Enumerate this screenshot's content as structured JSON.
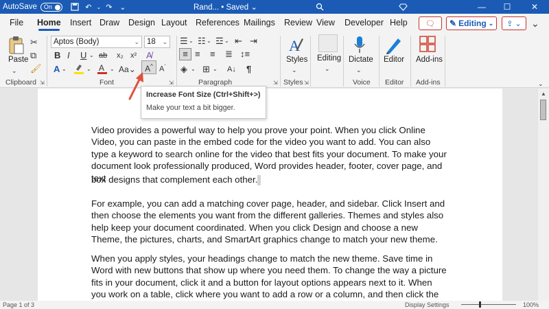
{
  "titlebar": {
    "autosave_label": "AutoSave",
    "autosave_state": "On",
    "doc_title": "Rand... • Saved",
    "doc_title_chevron": "⌄"
  },
  "tabs": [
    "File",
    "Home",
    "Insert",
    "Draw",
    "Design",
    "Layout",
    "References",
    "Mailings",
    "Review",
    "View",
    "Developer",
    "Help"
  ],
  "active_tab": "Home",
  "header_buttons": {
    "editing_label": "Editing"
  },
  "ribbon": {
    "clipboard": {
      "paste_label": "Paste",
      "group_label": "Clipboard"
    },
    "font": {
      "font_name": "Aptos (Body)",
      "font_size": "18",
      "group_label": "Font",
      "increase_font_label": "A^",
      "case_label": "Aa"
    },
    "paragraph": {
      "group_label": "Paragraph"
    },
    "styles": {
      "label": "Styles",
      "group_label": "Styles"
    },
    "editing": {
      "label": "Editing"
    },
    "voice": {
      "dictate_label": "Dictate",
      "group_label": "Voice"
    },
    "editor": {
      "label": "Editor",
      "group_label": "Editor"
    },
    "addins": {
      "label": "Add-ins",
      "group_label": "Add-ins"
    }
  },
  "tooltip": {
    "title": "Increase Font Size (Ctrl+Shift+>)",
    "description": "Make your text a bit bigger."
  },
  "document": {
    "paragraphs": [
      "Video provides a powerful way to help you prove your point. When you click Online Video, you can paste in the embed code for the video you want to add. You can also type a keyword to search online for the video that best fits your document. To make your document look professionally produced, Word provides header, footer, cover page, and text",
      "box designs that complement each other.",
      "For example, you can add a matching cover page, header, and sidebar. Click Insert and then choose the elements you want from the different galleries. Themes and styles also help keep your document coordinated. When you click Design and choose a new Theme, the pictures, charts, and SmartArt graphics change to match your new theme.",
      "When you apply styles, your headings change to match the new theme. Save time in Word with new buttons that show up where you need them. To change the way a picture fits in your document, click it and a button for layout options appears next to it. When you work on a table, click where you want to add a row or a column, and then click the plus sign."
    ]
  },
  "status": {
    "page": "Page 1 of 3",
    "display_settings": "Display Settings",
    "zoom": "100%"
  },
  "colors": {
    "accent": "#1b5bb5",
    "highlight": "#c7322c"
  }
}
